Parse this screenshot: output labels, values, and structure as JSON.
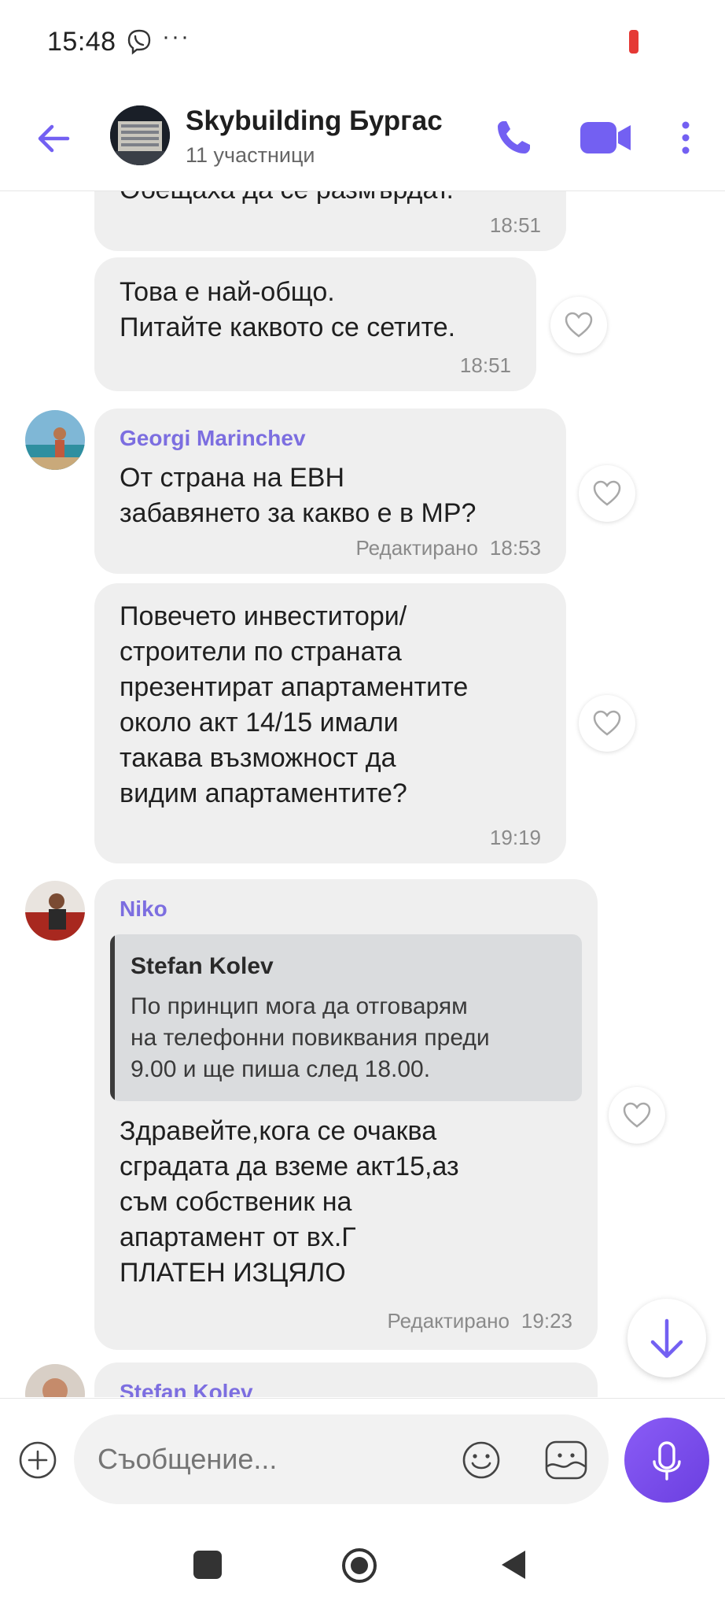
{
  "status_bar": {
    "time": "15:48",
    "dots": "···"
  },
  "header": {
    "title": "Skybuilding Бургас",
    "subtitle": "11 участници"
  },
  "messages": [
    {
      "text": "Обещаха да се размърдат.",
      "time": "18:51"
    },
    {
      "text": "Това е най-общо.\nПитайте каквото се сетите.",
      "time": "18:51"
    },
    {
      "sender": "Georgi Marinchev",
      "text": "От страна на ЕВН\nзабавянето за какво е в МР?",
      "edited": "Редактирано",
      "time": "18:53"
    },
    {
      "text": "Повечето инвеститори/\nстроители по страната\nпрезентират апартаментите\nоколо акт 14/15 имали\nтакава възможност да\nвидим апартаментите?",
      "time": "19:19"
    },
    {
      "sender": "Niko",
      "quote": {
        "name": "Stefan Kolev",
        "text": "По принцип мога да отговарям\nна телефонни повиквания преди\n9.00 и ще пиша след 18.00."
      },
      "text": "Здравейте,кога се очаква\nсградата да вземе акт15,аз\nсъм собственик на\nапартамент от вх.Г\nПЛАТЕН ИЗЦЯЛО",
      "edited": "Редактирано",
      "time": "19:23"
    },
    {
      "sender": "Stefan Kolev"
    }
  ],
  "composer": {
    "placeholder": "Съобщение..."
  },
  "colors": {
    "accent": "#7360f2",
    "bubble": "#efefef",
    "sender": "#7c6ee0"
  }
}
